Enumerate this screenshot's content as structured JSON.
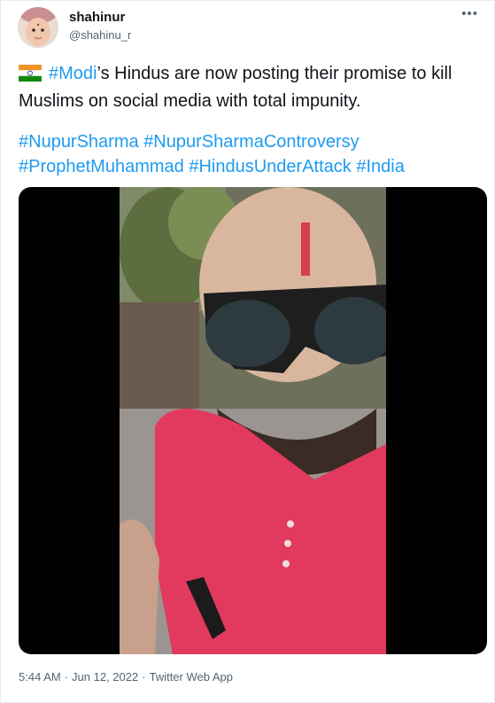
{
  "user": {
    "name": "shahinur",
    "handle": "@shahinu_r"
  },
  "tweet": {
    "hashtag_modi": "#Modi",
    "text_line1_rest": "’s Hindus are now posting their promise to kill Muslims on social media with total impunity.",
    "hashtags": [
      "#NupurSharma",
      "#NupurSharmaControversy",
      "#ProphetMuhammad",
      "#HindusUnderAttack",
      "#India"
    ]
  },
  "meta": {
    "time": "5:44 AM",
    "date": "Jun 12, 2022",
    "source": "Twitter Web App",
    "separator": "·"
  },
  "icons": {
    "more": "more-horizontal-icon",
    "flag": "india-flag-emoji"
  },
  "colors": {
    "link": "#1d9bf0",
    "secondary_text": "#536471",
    "border": "#e6ecf0"
  }
}
